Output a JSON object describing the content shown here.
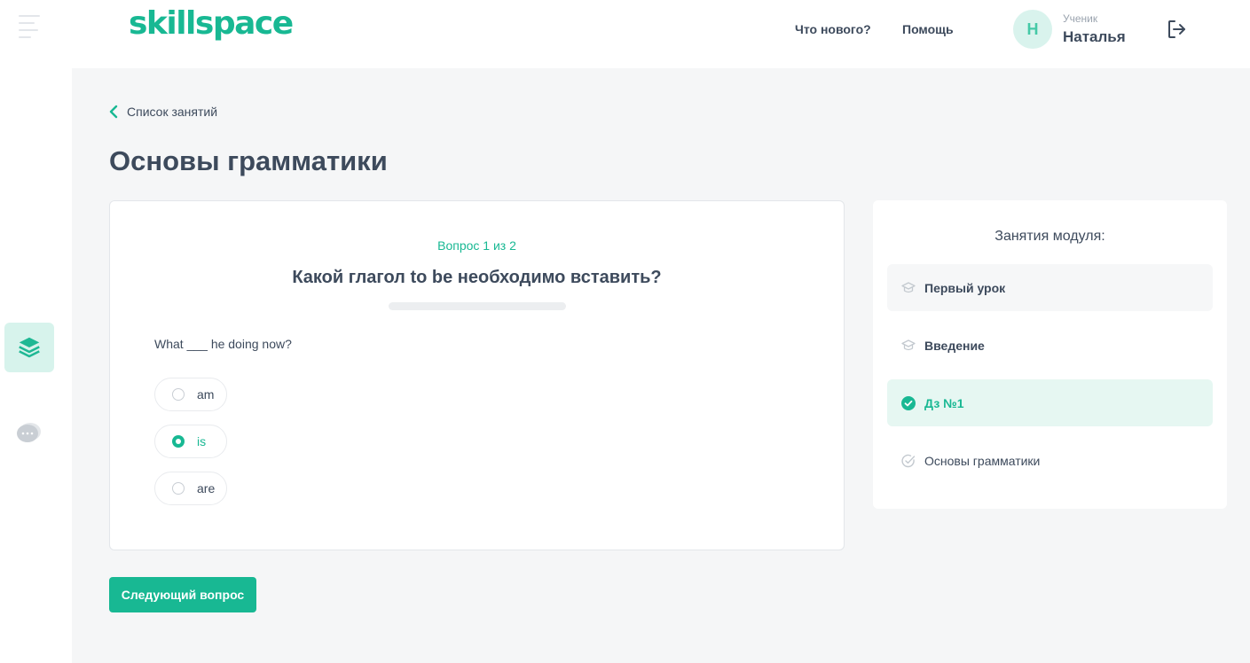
{
  "brand": {
    "logo_text": "skillspace",
    "accent": "#18b893"
  },
  "header": {
    "nav": {
      "whats_new": "Что нового?",
      "help": "Помощь"
    },
    "user": {
      "initial": "Н",
      "role": "Ученик",
      "name": "Наталья"
    }
  },
  "rail": {
    "icons": [
      "menu-icon",
      "layers-icon",
      "chat-icon"
    ]
  },
  "back_link": "Список занятий",
  "page_title": "Основы грамматики",
  "quiz": {
    "counter": "Вопрос 1 из 2",
    "title": "Какой глагол to be необходимо вставить?",
    "sentence": "What ___ he doing now?",
    "options": [
      {
        "label": "am",
        "checked": false
      },
      {
        "label": "is",
        "checked": true
      },
      {
        "label": "are",
        "checked": false
      }
    ],
    "next_label": "Следующий вопрос"
  },
  "module": {
    "title": "Занятия модуля:",
    "lessons": [
      {
        "label": "Первый урок",
        "icon": "graduation-cap-icon",
        "state": "visited"
      },
      {
        "label": "Введение",
        "icon": "graduation-cap-icon",
        "state": "default"
      },
      {
        "label": "Дз №1",
        "icon": "check-circle-icon",
        "state": "active"
      },
      {
        "label": "Основы грамматики",
        "icon": "check-outline-icon",
        "state": "default"
      }
    ]
  }
}
